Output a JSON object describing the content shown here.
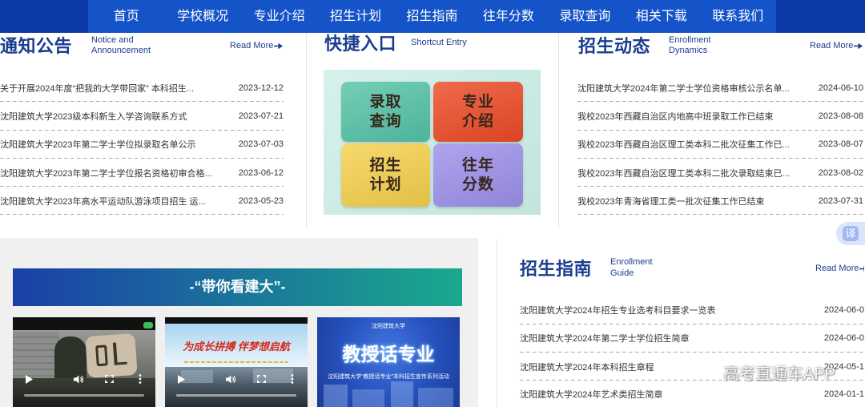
{
  "colors": {
    "nav_bg": "#0b39a6",
    "nav_band": "#1553c9",
    "title_blue": "#1b3d8e",
    "text": "#333333",
    "divider": "#e6e6e6",
    "dashed": "#a6a6a6",
    "panel_bg": "#f0f0f0",
    "banner_start": "#1b3fa8",
    "banner_end": "#1aa98d",
    "shortcut_bg": "#c9ece5"
  },
  "nav": {
    "items": [
      "首页",
      "学校概况",
      "专业介绍",
      "招生计划",
      "招生指南",
      "往年分数",
      "录取查询",
      "相关下载",
      "联系我们"
    ]
  },
  "notice": {
    "title": "通知公告",
    "subtitle": [
      "Notice and",
      "Announcement"
    ],
    "read_more": "Read More",
    "read_more_icon": "arrow-right-icon",
    "items": [
      {
        "text": "关于开展2024年度“把我的大学带回家” 本科招生...",
        "date": "2023-12-12"
      },
      {
        "text": "沈阳建筑大学2023级本科新生入学咨询联系方式",
        "date": "2023-07-21"
      },
      {
        "text": "沈阳建筑大学2023年第二学士学位拟录取名单公示",
        "date": "2023-07-03"
      },
      {
        "text": "沈阳建筑大学2023年第二学士学位报名资格初审合格...",
        "date": "2023-06-12"
      },
      {
        "text": "沈阳建筑大学2023年高水平运动队游泳项目招生 运...",
        "date": "2023-05-23"
      }
    ]
  },
  "shortcut": {
    "title": "快捷入口",
    "subtitle": "Shortcut Entry",
    "tiles": [
      {
        "lines": [
          "录取",
          "查询"
        ],
        "color": "#55c3a6"
      },
      {
        "lines": [
          "专业",
          "介绍"
        ],
        "color": "#ec4a25"
      },
      {
        "lines": [
          "招生",
          "计划"
        ],
        "color": "#f5d04d"
      },
      {
        "lines": [
          "往年",
          "分数"
        ],
        "color": "#9d90ea"
      }
    ]
  },
  "dynamics": {
    "title": "招生动态",
    "subtitle": [
      "Enrollment",
      "Dynamics"
    ],
    "read_more": "Read More",
    "read_more_icon": "arrow-right-icon",
    "items": [
      {
        "text": "沈阳建筑大学2024年第二学士学位资格审核公示名单...",
        "date": "2024-06-10"
      },
      {
        "text": "我校2023年西藏自治区内地高中班录取工作已结束",
        "date": "2023-08-08"
      },
      {
        "text": "我校2023年西藏自治区理工类本科二批次征集工作已...",
        "date": "2023-08-07"
      },
      {
        "text": "我校2023年西藏自治区理工类本科二批次录取结束已...",
        "date": "2023-08-02"
      },
      {
        "text": "我校2023年青海省理工类一批次征集工作已结束",
        "date": "2023-07-31"
      }
    ]
  },
  "video_section": {
    "banner": "-“带你看建大”-",
    "videos": [
      {
        "controls": [
          "play-icon",
          "volume-icon",
          "fullscreen-icon",
          "more-icon"
        ]
      },
      {
        "caption": "为成长拼搏 伴梦想启航",
        "controls": [
          "play-icon",
          "volume-icon",
          "fullscreen-icon",
          "more-icon"
        ]
      },
      {
        "logo": "沈阳建筑大学",
        "caption": "教授话专业",
        "subcaption": "沈阳建筑大学“教授话专业”本科招生宣传系列活动"
      }
    ]
  },
  "guide": {
    "title": "招生指南",
    "subtitle": [
      "Enrollment",
      "Guide"
    ],
    "read_more": "Read More",
    "read_more_icon": "arrow-right-icon",
    "items": [
      {
        "text": "沈阳建筑大学2024年招生专业选考科目要求一览表",
        "date": "2024-06-0"
      },
      {
        "text": "沈阳建筑大学2024年第二学士学位招生简章",
        "date": "2024-06-0"
      },
      {
        "text": "沈阳建筑大学2024年本科招生章程",
        "date": "2024-05-1"
      },
      {
        "text": "沈阳建筑大学2024年艺术类招生简章",
        "date": "2024-01-1"
      }
    ]
  },
  "translate_button": "译",
  "watermark": "高考直通车APP"
}
